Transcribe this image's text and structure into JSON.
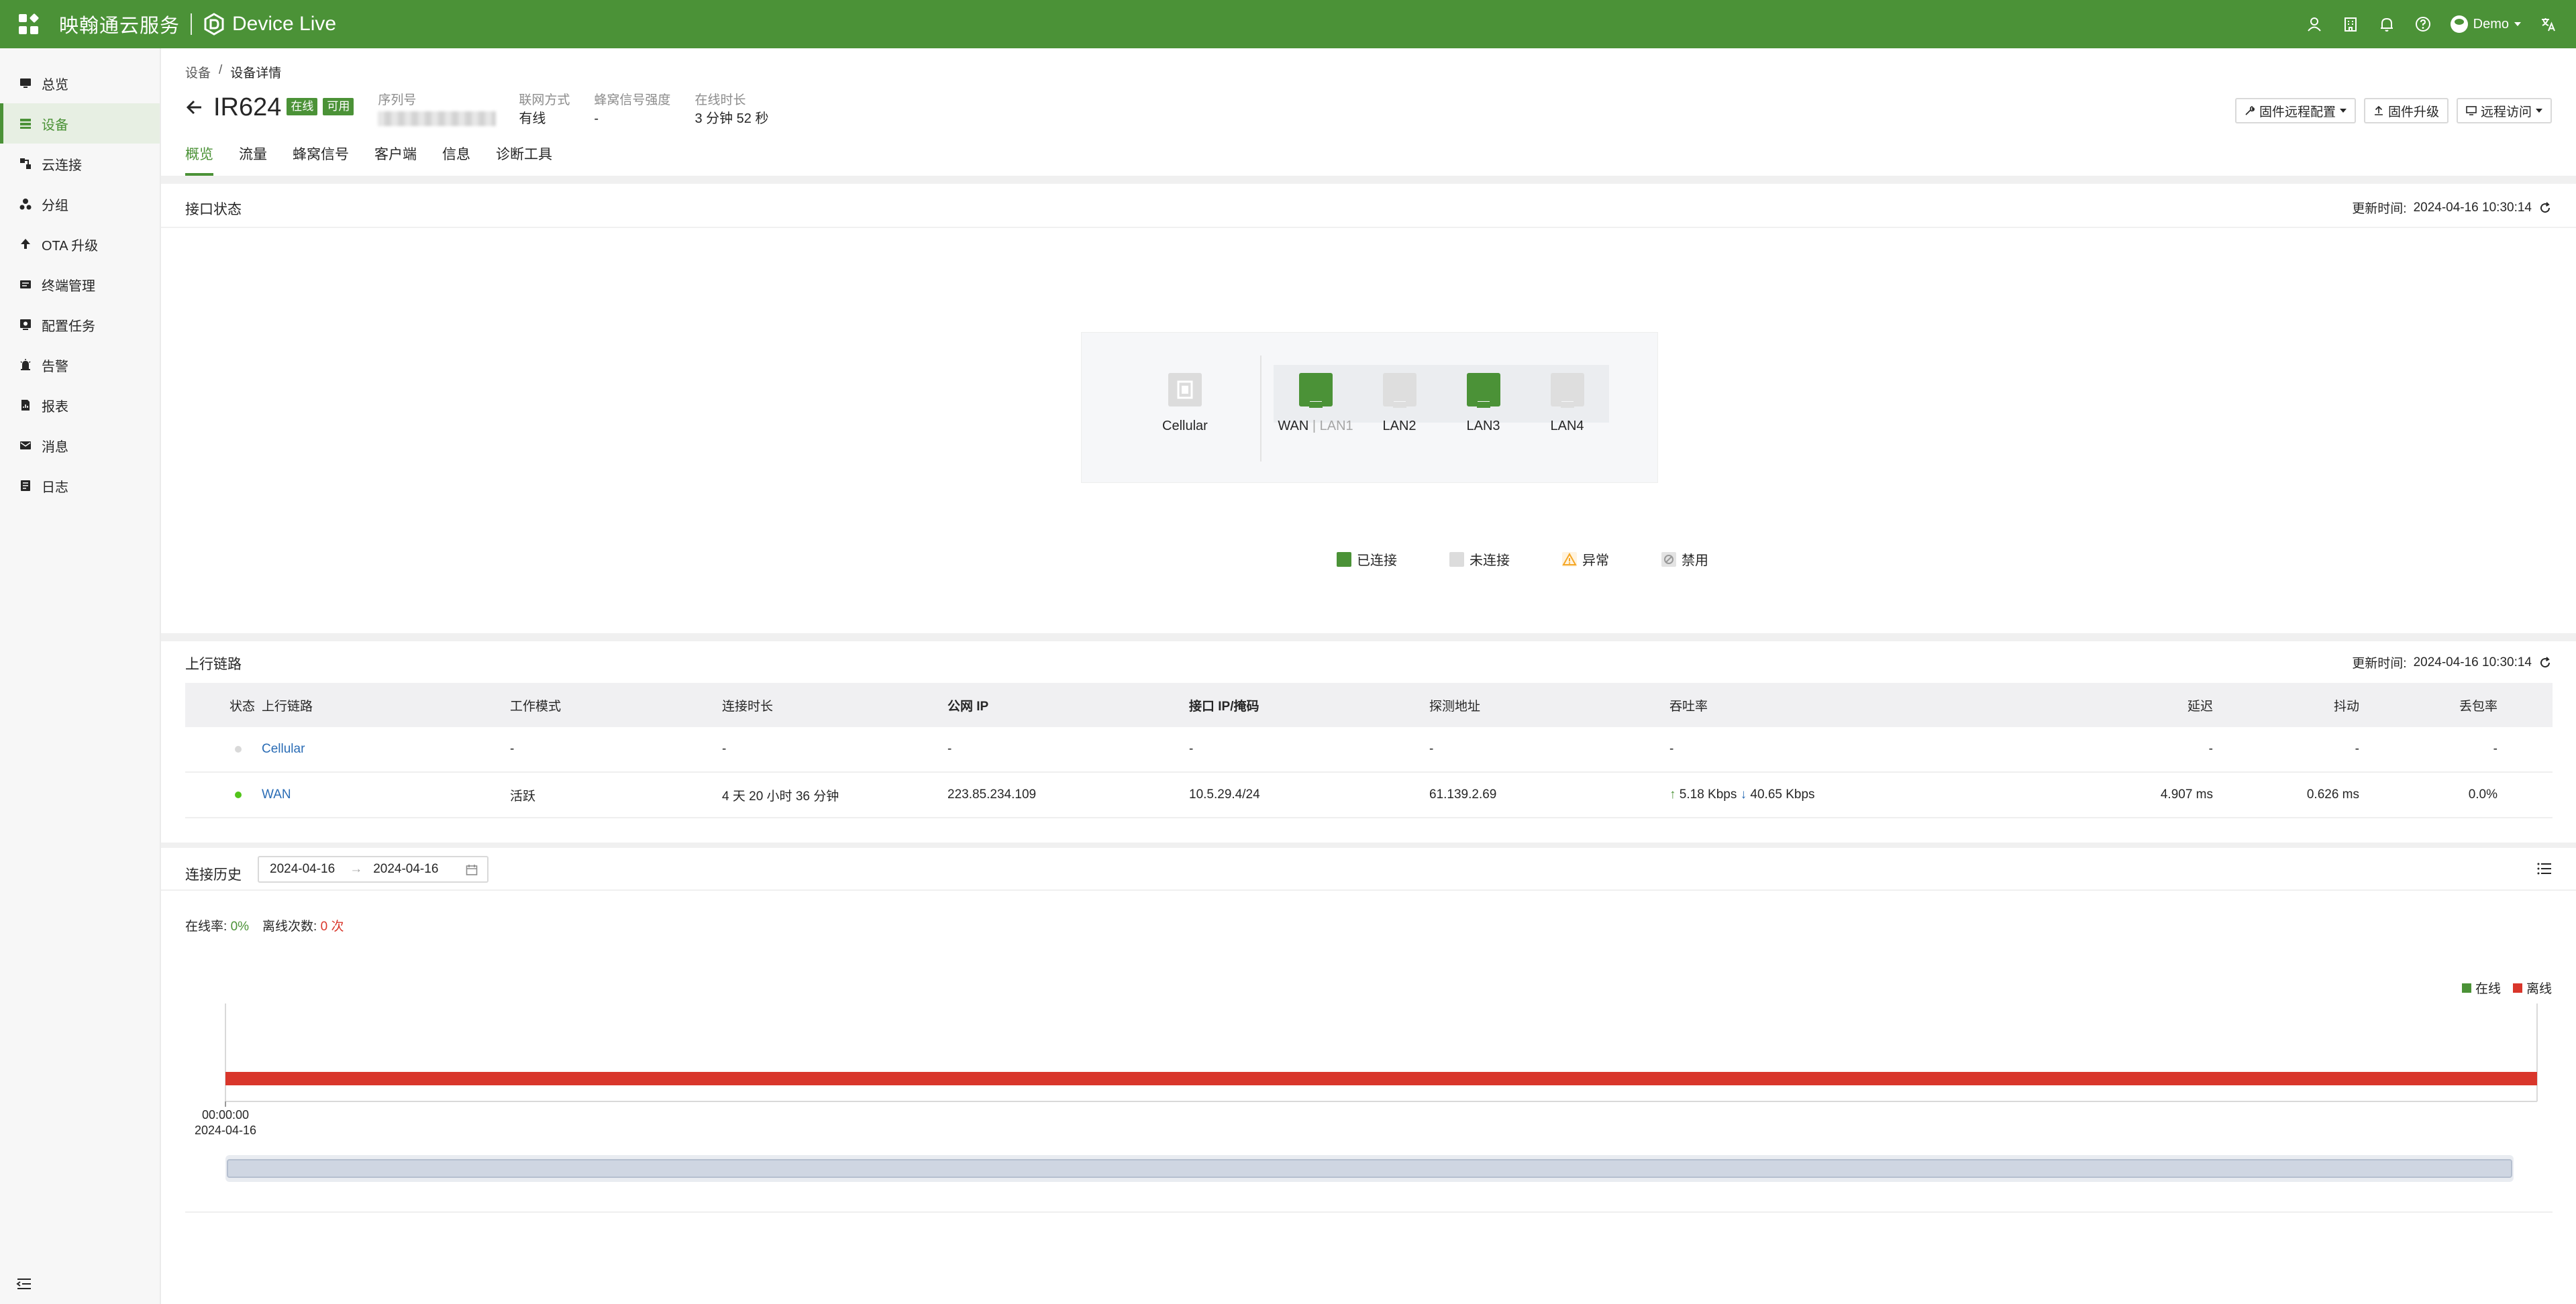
{
  "topbar": {
    "brand_cn": "映翰通云服务",
    "brand_en": "Device Live",
    "user": "Demo",
    "icons": [
      "user-icon",
      "building-icon",
      "bell-icon",
      "help-icon",
      "translate-icon"
    ]
  },
  "sidebar": {
    "items": [
      {
        "label": "总览",
        "icon": "dashboard-icon"
      },
      {
        "label": "设备",
        "icon": "device-list-icon",
        "active": true
      },
      {
        "label": "云连接",
        "icon": "cloud-connect-icon"
      },
      {
        "label": "分组",
        "icon": "group-icon"
      },
      {
        "label": "OTA 升级",
        "icon": "ota-upload-icon"
      },
      {
        "label": "终端管理",
        "icon": "terminal-icon"
      },
      {
        "label": "配置任务",
        "icon": "config-task-icon"
      },
      {
        "label": "告警",
        "icon": "alarm-icon"
      },
      {
        "label": "报表",
        "icon": "report-icon"
      },
      {
        "label": "消息",
        "icon": "message-icon"
      },
      {
        "label": "日志",
        "icon": "log-icon"
      }
    ]
  },
  "breadcrumb": {
    "root": "设备",
    "sep": "/",
    "current": "设备详情"
  },
  "device": {
    "name": "IR624",
    "status_badge": "在线",
    "usable_badge": "可用",
    "serial_label": "序列号",
    "conn_label": "联网方式",
    "conn_value": "有线",
    "signal_label": "蜂窝信号强度",
    "signal_value": "-",
    "uptime_label": "在线时长",
    "uptime_value": "3 分钟 52 秒"
  },
  "actions": {
    "remote_config": "固件远程配置",
    "firmware_upgrade": "固件升级",
    "remote_access": "远程访问"
  },
  "tabs": [
    "概览",
    "流量",
    "蜂窝信号",
    "客户端",
    "信息",
    "诊断工具"
  ],
  "interface_status": {
    "title": "接口状态",
    "updated_label": "更新时间:",
    "updated_value": "2024-04-16 10:30:14",
    "ports": [
      {
        "name": "Cellular",
        "state": "sim"
      },
      {
        "name": "WAN",
        "alt": "LAN1",
        "state": "connected"
      },
      {
        "name": "LAN2",
        "state": "disconnected"
      },
      {
        "name": "LAN3",
        "state": "connected"
      },
      {
        "name": "LAN4",
        "state": "disconnected"
      }
    ],
    "legend": [
      {
        "label": "已连接",
        "color": "#4b9237"
      },
      {
        "label": "未连接",
        "color": "#dcdcdc"
      },
      {
        "label": "异常",
        "color": "#f5a623"
      },
      {
        "label": "禁用",
        "color": "#c8c8c8"
      }
    ]
  },
  "uplink": {
    "title": "上行链路",
    "updated_label": "更新时间:",
    "updated_value": "2024-04-16 10:30:14",
    "columns": [
      "状态",
      "上行链路",
      "工作模式",
      "连接时长",
      "公网 IP",
      "接口 IP/掩码",
      "探测地址",
      "吞吐率",
      "延迟",
      "抖动",
      "丢包率"
    ],
    "rows": [
      {
        "status": "offline",
        "link": "Cellular",
        "mode": "-",
        "duration": "-",
        "public_ip": "-",
        "iface_ip": "-",
        "probe": "-",
        "throughput_up": "",
        "throughput_down": "",
        "throughput": "-",
        "latency": "-",
        "jitter": "-",
        "loss": "-"
      },
      {
        "status": "online",
        "link": "WAN",
        "mode": "活跃",
        "duration": "4 天 20 小时 36 分钟",
        "public_ip": "223.85.234.109",
        "iface_ip": "10.5.29.4/24",
        "probe": "61.139.2.69",
        "throughput_up": "5.18 Kbps",
        "throughput_down": "40.65 Kbps",
        "throughput": "",
        "latency": "4.907 ms",
        "jitter": "0.626 ms",
        "loss": "0.0%"
      }
    ]
  },
  "history": {
    "title": "连接历史",
    "date_start": "2024-04-16",
    "date_end": "2024-04-16",
    "date_arrow": "→",
    "online_rate_label": "在线率:",
    "online_rate_value": "0%",
    "offline_count_label": "离线次数:",
    "offline_count_value": "0 次"
  },
  "chart_data": {
    "type": "timeline",
    "series": [
      {
        "name": "在线",
        "color": "#4b9237",
        "segments": []
      },
      {
        "name": "离线",
        "color": "#d9362b",
        "segments": [
          [
            "2024-04-16 00:00:00",
            "2024-04-16 10:30:14"
          ]
        ]
      }
    ],
    "x_tick_labels": [
      {
        "time": "00:00:00",
        "date": "2024-04-16"
      }
    ]
  }
}
